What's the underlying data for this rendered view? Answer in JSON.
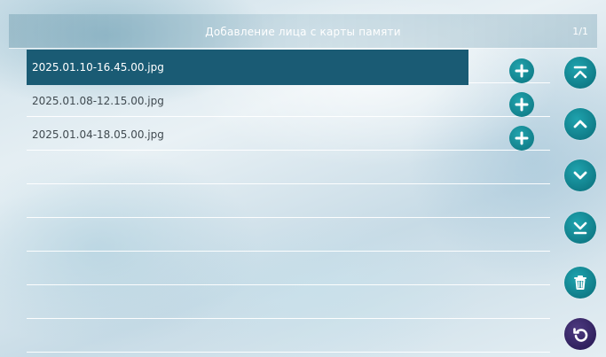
{
  "header": {
    "title": "Добавление лица с карты памяти",
    "page": "1/1"
  },
  "files": [
    {
      "name": "2025.01.10-16.45.00.jpg",
      "selected": true
    },
    {
      "name": "2025.01.08-12.15.00.jpg",
      "selected": false
    },
    {
      "name": "2025.01.04-18.05.00.jpg",
      "selected": false
    },
    {
      "name": "",
      "selected": false
    },
    {
      "name": "",
      "selected": false
    },
    {
      "name": "",
      "selected": false
    },
    {
      "name": "",
      "selected": false
    },
    {
      "name": "",
      "selected": false
    },
    {
      "name": "",
      "selected": false
    }
  ],
  "icons": {
    "add": "plus-icon",
    "first_page": "double-chevron-up-icon",
    "prev": "chevron-up-icon",
    "next": "chevron-down-icon",
    "last_page": "double-chevron-down-icon",
    "delete": "trash-icon",
    "back": "undo-icon"
  },
  "colors": {
    "accent": "#12818c",
    "selected_row": "#1a5b74",
    "back_button": "#2e1f5c"
  }
}
